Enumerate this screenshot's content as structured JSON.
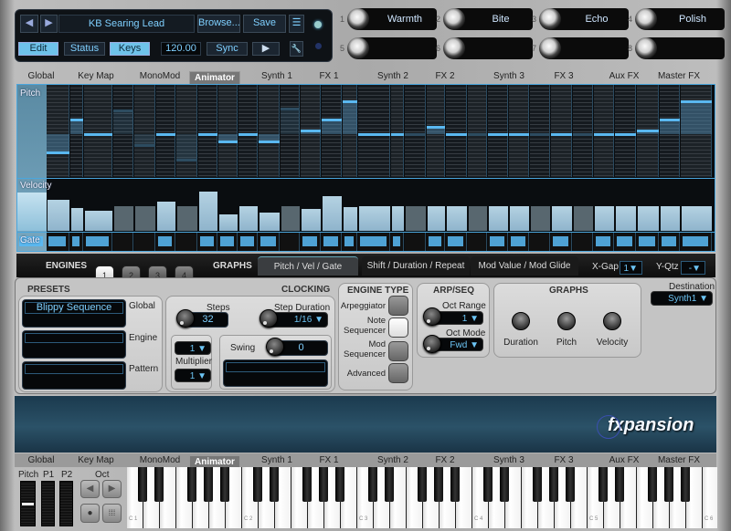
{
  "header": {
    "preset_name": "KB Searing Lead",
    "browse": "Browse...",
    "save": "Save",
    "prev_icon": "arrow-left",
    "next_icon": "arrow-right",
    "list_icon": "list-icon",
    "edit": "Edit",
    "status": "Status",
    "keys": "Keys",
    "tempo": "120.00",
    "sync": "Sync",
    "play_icon": "play",
    "wrench_icon": "wrench",
    "accent": "#6ec2ea"
  },
  "macros": [
    {
      "n": "1",
      "label": "Warmth"
    },
    {
      "n": "2",
      "label": "Bite"
    },
    {
      "n": "3",
      "label": "Echo"
    },
    {
      "n": "4",
      "label": "Polish"
    },
    {
      "n": "5",
      "label": ""
    },
    {
      "n": "6",
      "label": ""
    },
    {
      "n": "7",
      "label": ""
    },
    {
      "n": "8",
      "label": ""
    }
  ],
  "tabs": [
    "Global",
    "Key Map",
    "MonoMod",
    "Animator",
    "Synth 1",
    "FX 1",
    "Synth 2",
    "FX 2",
    "Synth 3",
    "FX 3",
    "Aux FX",
    "Master FX"
  ],
  "active_tab": "Animator",
  "sequencer": {
    "pitch_label": "Pitch",
    "velocity_label": "Velocity",
    "gate_label": "Gate",
    "pitch": [
      -5,
      4,
      0,
      6.5,
      -3,
      0,
      -7,
      0,
      -2,
      0,
      -2,
      7,
      1,
      4,
      9,
      0,
      0,
      0,
      2,
      0,
      0,
      0,
      0,
      0,
      0,
      0,
      0,
      0,
      1,
      4,
      9
    ],
    "velocity": [
      61,
      44,
      40,
      49,
      49,
      58,
      49,
      77,
      32,
      49,
      35,
      49,
      42,
      67,
      46,
      49,
      49,
      49,
      49,
      49,
      49,
      49,
      49,
      49,
      49,
      49,
      49,
      49,
      49,
      49,
      49
    ],
    "gate": [
      1,
      1,
      1,
      0,
      0,
      1,
      0,
      1,
      1,
      1,
      1,
      0,
      1,
      1,
      1,
      1,
      1,
      0,
      1,
      1,
      0,
      1,
      1,
      0,
      1,
      0,
      1,
      1,
      1,
      1,
      1
    ]
  },
  "engines": {
    "label": "ENGINES",
    "buttons": [
      "1",
      "2",
      "3",
      "4"
    ],
    "active": "1",
    "graphs_label": "GRAPHS",
    "graph_tabs": [
      "Pitch / Vel / Gate",
      "Shift / Duration / Repeat",
      "Mod Value / Mod Glide"
    ],
    "xgap_label": "X-Gap",
    "xgap": "1",
    "yqtz_label": "Y-Qtz",
    "yqtz": "-"
  },
  "presets": {
    "title": "PRESETS",
    "global_label": "Global",
    "global_value": "Blippy Sequence",
    "engine_label": "Engine",
    "pattern_label": "Pattern"
  },
  "clocking": {
    "title": "CLOCKING",
    "steps_label": "Steps",
    "steps": "32",
    "step_duration_label": "Step Duration",
    "step_duration": "1/16",
    "divider": "1",
    "multiplier_label": "Multiplier",
    "multiplier": "1",
    "swing_label": "Swing",
    "swing": "0"
  },
  "engine_type": {
    "title": "ENGINE TYPE",
    "options": [
      "Arpeggiator",
      "Note Sequencer",
      "Mod Sequencer",
      "Advanced"
    ],
    "selected": "Note Sequencer"
  },
  "arpseq": {
    "title": "ARP/SEQ",
    "oct_range_label": "Oct Range",
    "oct_range": "1",
    "oct_mode_label": "Oct Mode",
    "oct_mode": "Fwd"
  },
  "graphs": {
    "title": "GRAPHS",
    "knobs": [
      "Duration",
      "Pitch",
      "Velocity"
    ]
  },
  "destination": {
    "label": "Destination",
    "value": "Synth1"
  },
  "brand": "fxpansion",
  "bottom": {
    "pitch": "Pitch",
    "p1": "P1",
    "p2": "P2",
    "oct": "Oct",
    "pitch_wheel_level": 50,
    "key_labels": [
      "C 1",
      "C 2",
      "C 3",
      "C 4",
      "C 5",
      "C 6"
    ]
  }
}
